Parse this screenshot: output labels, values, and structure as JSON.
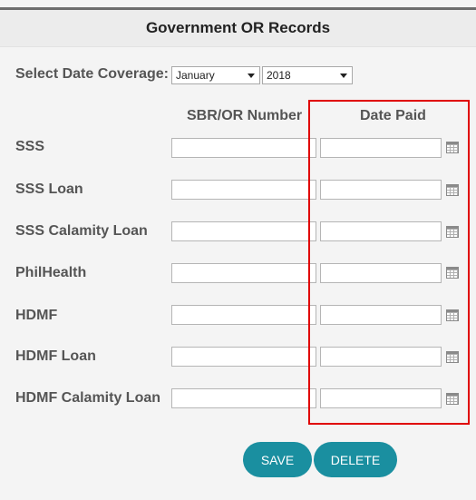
{
  "header": {
    "title": "Government OR Records"
  },
  "coverage": {
    "label": "Select Date Coverage:",
    "month": "January",
    "year": "2018"
  },
  "columns": {
    "number": "SBR/OR Number",
    "date": "Date Paid"
  },
  "rows": [
    {
      "label": "SSS",
      "number": "",
      "date": ""
    },
    {
      "label": "SSS Loan",
      "number": "",
      "date": ""
    },
    {
      "label": "SSS Calamity Loan",
      "number": "",
      "date": ""
    },
    {
      "label": "PhilHealth",
      "number": "",
      "date": ""
    },
    {
      "label": "HDMF",
      "number": "",
      "date": ""
    },
    {
      "label": "HDMF Loan",
      "number": "",
      "date": ""
    },
    {
      "label": "HDMF Calamity Loan",
      "number": "",
      "date": ""
    }
  ],
  "buttons": {
    "save": "SAVE",
    "delete": "DELETE"
  },
  "icons": {
    "calendar": "calendar-icon"
  },
  "colors": {
    "accent": "#1a8fa0",
    "highlight": "#e00000"
  }
}
